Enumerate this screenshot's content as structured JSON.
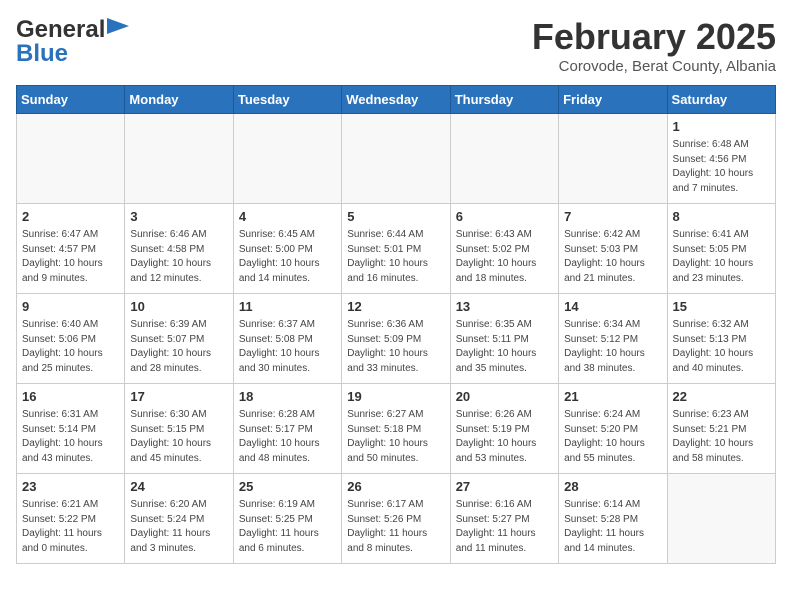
{
  "logo": {
    "part1": "General",
    "part2": "Blue"
  },
  "title": "February 2025",
  "subtitle": "Corovode, Berat County, Albania",
  "days_of_week": [
    "Sunday",
    "Monday",
    "Tuesday",
    "Wednesday",
    "Thursday",
    "Friday",
    "Saturday"
  ],
  "weeks": [
    [
      {
        "day": "",
        "info": ""
      },
      {
        "day": "",
        "info": ""
      },
      {
        "day": "",
        "info": ""
      },
      {
        "day": "",
        "info": ""
      },
      {
        "day": "",
        "info": ""
      },
      {
        "day": "",
        "info": ""
      },
      {
        "day": "1",
        "info": "Sunrise: 6:48 AM\nSunset: 4:56 PM\nDaylight: 10 hours and 7 minutes."
      }
    ],
    [
      {
        "day": "2",
        "info": "Sunrise: 6:47 AM\nSunset: 4:57 PM\nDaylight: 10 hours and 9 minutes."
      },
      {
        "day": "3",
        "info": "Sunrise: 6:46 AM\nSunset: 4:58 PM\nDaylight: 10 hours and 12 minutes."
      },
      {
        "day": "4",
        "info": "Sunrise: 6:45 AM\nSunset: 5:00 PM\nDaylight: 10 hours and 14 minutes."
      },
      {
        "day": "5",
        "info": "Sunrise: 6:44 AM\nSunset: 5:01 PM\nDaylight: 10 hours and 16 minutes."
      },
      {
        "day": "6",
        "info": "Sunrise: 6:43 AM\nSunset: 5:02 PM\nDaylight: 10 hours and 18 minutes."
      },
      {
        "day": "7",
        "info": "Sunrise: 6:42 AM\nSunset: 5:03 PM\nDaylight: 10 hours and 21 minutes."
      },
      {
        "day": "8",
        "info": "Sunrise: 6:41 AM\nSunset: 5:05 PM\nDaylight: 10 hours and 23 minutes."
      }
    ],
    [
      {
        "day": "9",
        "info": "Sunrise: 6:40 AM\nSunset: 5:06 PM\nDaylight: 10 hours and 25 minutes."
      },
      {
        "day": "10",
        "info": "Sunrise: 6:39 AM\nSunset: 5:07 PM\nDaylight: 10 hours and 28 minutes."
      },
      {
        "day": "11",
        "info": "Sunrise: 6:37 AM\nSunset: 5:08 PM\nDaylight: 10 hours and 30 minutes."
      },
      {
        "day": "12",
        "info": "Sunrise: 6:36 AM\nSunset: 5:09 PM\nDaylight: 10 hours and 33 minutes."
      },
      {
        "day": "13",
        "info": "Sunrise: 6:35 AM\nSunset: 5:11 PM\nDaylight: 10 hours and 35 minutes."
      },
      {
        "day": "14",
        "info": "Sunrise: 6:34 AM\nSunset: 5:12 PM\nDaylight: 10 hours and 38 minutes."
      },
      {
        "day": "15",
        "info": "Sunrise: 6:32 AM\nSunset: 5:13 PM\nDaylight: 10 hours and 40 minutes."
      }
    ],
    [
      {
        "day": "16",
        "info": "Sunrise: 6:31 AM\nSunset: 5:14 PM\nDaylight: 10 hours and 43 minutes."
      },
      {
        "day": "17",
        "info": "Sunrise: 6:30 AM\nSunset: 5:15 PM\nDaylight: 10 hours and 45 minutes."
      },
      {
        "day": "18",
        "info": "Sunrise: 6:28 AM\nSunset: 5:17 PM\nDaylight: 10 hours and 48 minutes."
      },
      {
        "day": "19",
        "info": "Sunrise: 6:27 AM\nSunset: 5:18 PM\nDaylight: 10 hours and 50 minutes."
      },
      {
        "day": "20",
        "info": "Sunrise: 6:26 AM\nSunset: 5:19 PM\nDaylight: 10 hours and 53 minutes."
      },
      {
        "day": "21",
        "info": "Sunrise: 6:24 AM\nSunset: 5:20 PM\nDaylight: 10 hours and 55 minutes."
      },
      {
        "day": "22",
        "info": "Sunrise: 6:23 AM\nSunset: 5:21 PM\nDaylight: 10 hours and 58 minutes."
      }
    ],
    [
      {
        "day": "23",
        "info": "Sunrise: 6:21 AM\nSunset: 5:22 PM\nDaylight: 11 hours and 0 minutes."
      },
      {
        "day": "24",
        "info": "Sunrise: 6:20 AM\nSunset: 5:24 PM\nDaylight: 11 hours and 3 minutes."
      },
      {
        "day": "25",
        "info": "Sunrise: 6:19 AM\nSunset: 5:25 PM\nDaylight: 11 hours and 6 minutes."
      },
      {
        "day": "26",
        "info": "Sunrise: 6:17 AM\nSunset: 5:26 PM\nDaylight: 11 hours and 8 minutes."
      },
      {
        "day": "27",
        "info": "Sunrise: 6:16 AM\nSunset: 5:27 PM\nDaylight: 11 hours and 11 minutes."
      },
      {
        "day": "28",
        "info": "Sunrise: 6:14 AM\nSunset: 5:28 PM\nDaylight: 11 hours and 14 minutes."
      },
      {
        "day": "",
        "info": ""
      }
    ]
  ]
}
